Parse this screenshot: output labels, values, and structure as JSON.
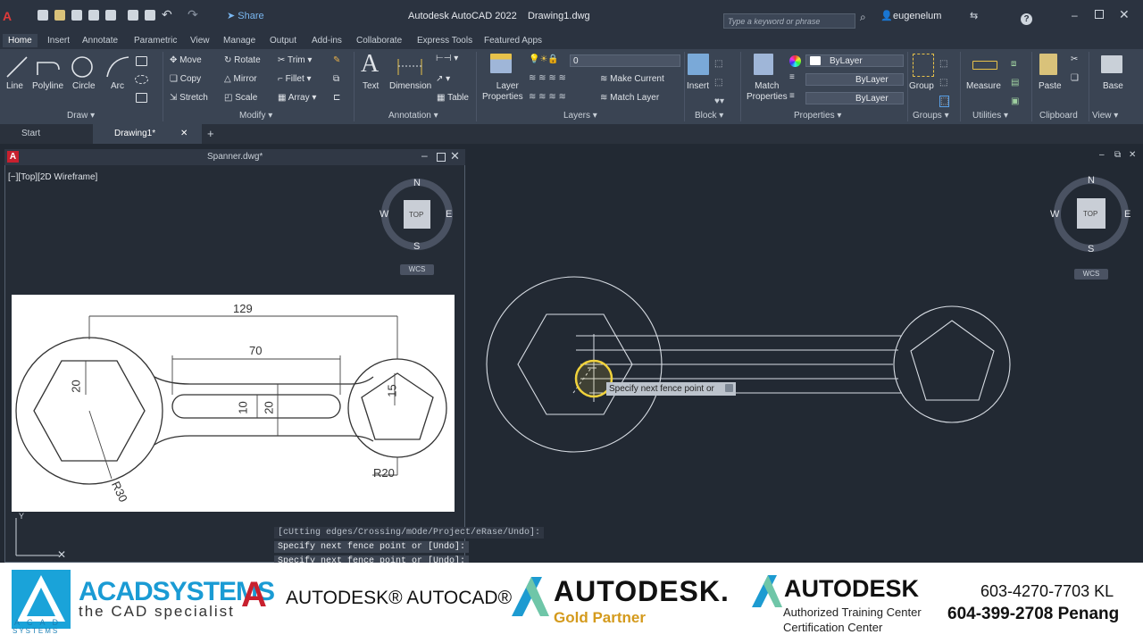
{
  "app": {
    "title": "Autodesk AutoCAD 2022",
    "filename": "Drawing1.dwg",
    "share_label": "Share",
    "search_placeholder": "Type a keyword or phrase",
    "username": "eugenelum"
  },
  "ribbon_tabs": [
    "Home",
    "Insert",
    "Annotate",
    "Parametric",
    "View",
    "Manage",
    "Output",
    "Add-ins",
    "Collaborate",
    "Express Tools",
    "Featured Apps"
  ],
  "draw_panel": {
    "title": "Draw",
    "tools": [
      "Line",
      "Polyline",
      "Circle",
      "Arc"
    ]
  },
  "modify_panel": {
    "title": "Modify",
    "tools": [
      "Move",
      "Rotate",
      "Trim",
      "Copy",
      "Mirror",
      "Fillet",
      "Stretch",
      "Scale",
      "Array"
    ]
  },
  "annotation_panel": {
    "title": "Annotation",
    "tools": [
      "Text",
      "Dimension",
      "Table"
    ]
  },
  "layers_panel": {
    "title": "Layers",
    "layer_props": "Layer",
    "layer_props2": "Properties",
    "current_layer": "0",
    "make_current": "Make Current",
    "match_layer": "Match Layer"
  },
  "block_panel": {
    "title": "Block",
    "insert": "Insert"
  },
  "properties_panel": {
    "title": "Properties",
    "match": "Match",
    "match2": "Properties",
    "color": "ByLayer",
    "linetype": "ByLayer",
    "lineweight": "ByLayer"
  },
  "groups_panel": {
    "title": "Groups",
    "group": "Group"
  },
  "utilities_panel": {
    "title": "Utilities",
    "measure": "Measure"
  },
  "clipboard_panel": {
    "title": "Clipboard",
    "paste": "Paste"
  },
  "view_panel": {
    "title": "View",
    "base": "Base"
  },
  "file_tabs": {
    "start": "Start",
    "drawing": "Drawing1*"
  },
  "subwindow": {
    "title": "Spanner.dwg*",
    "viewport_label": "[−][Top][2D Wireframe]"
  },
  "viewcube": {
    "n": "N",
    "s": "S",
    "e": "E",
    "w": "W",
    "top": "TOP",
    "wcs": "WCS"
  },
  "reference_drawing": {
    "dim_129": "129",
    "dim_70": "70",
    "dim_20": "20",
    "dim_10": "10",
    "dim_20b": "20",
    "dim_15": "15",
    "r30": "R30",
    "r20": "R20"
  },
  "tooltip": "Specify next fence point or",
  "command_lines": [
    "[cUtting edges/Crossing/mOde/Project/eRase/Undo]:",
    "Specify next fence point or [Undo]:",
    "Specify next fence point or [Undo]:"
  ],
  "footer": {
    "acad": "ACADSYSTEMS",
    "acad_tag": "the CAD specialist",
    "acad_sub": "SYSTEMS",
    "acad_logo_letters": "A C A D",
    "autocad": "AUTODESK® AUTOCAD®",
    "autodesk": "AUTODESK.",
    "gold": "Gold Partner",
    "autodesk2": "AUTODESK",
    "atc": "Authorized Training Center",
    "cert": "Certification Center",
    "phone1": "603-4270-7703 KL",
    "phone2": "604-399-2708 Penang"
  },
  "colors": {
    "ribbon": "#3a4453",
    "canvas": "#222933",
    "accent_blue": "#3d9be9",
    "autodesk_red": "#c8202e"
  }
}
